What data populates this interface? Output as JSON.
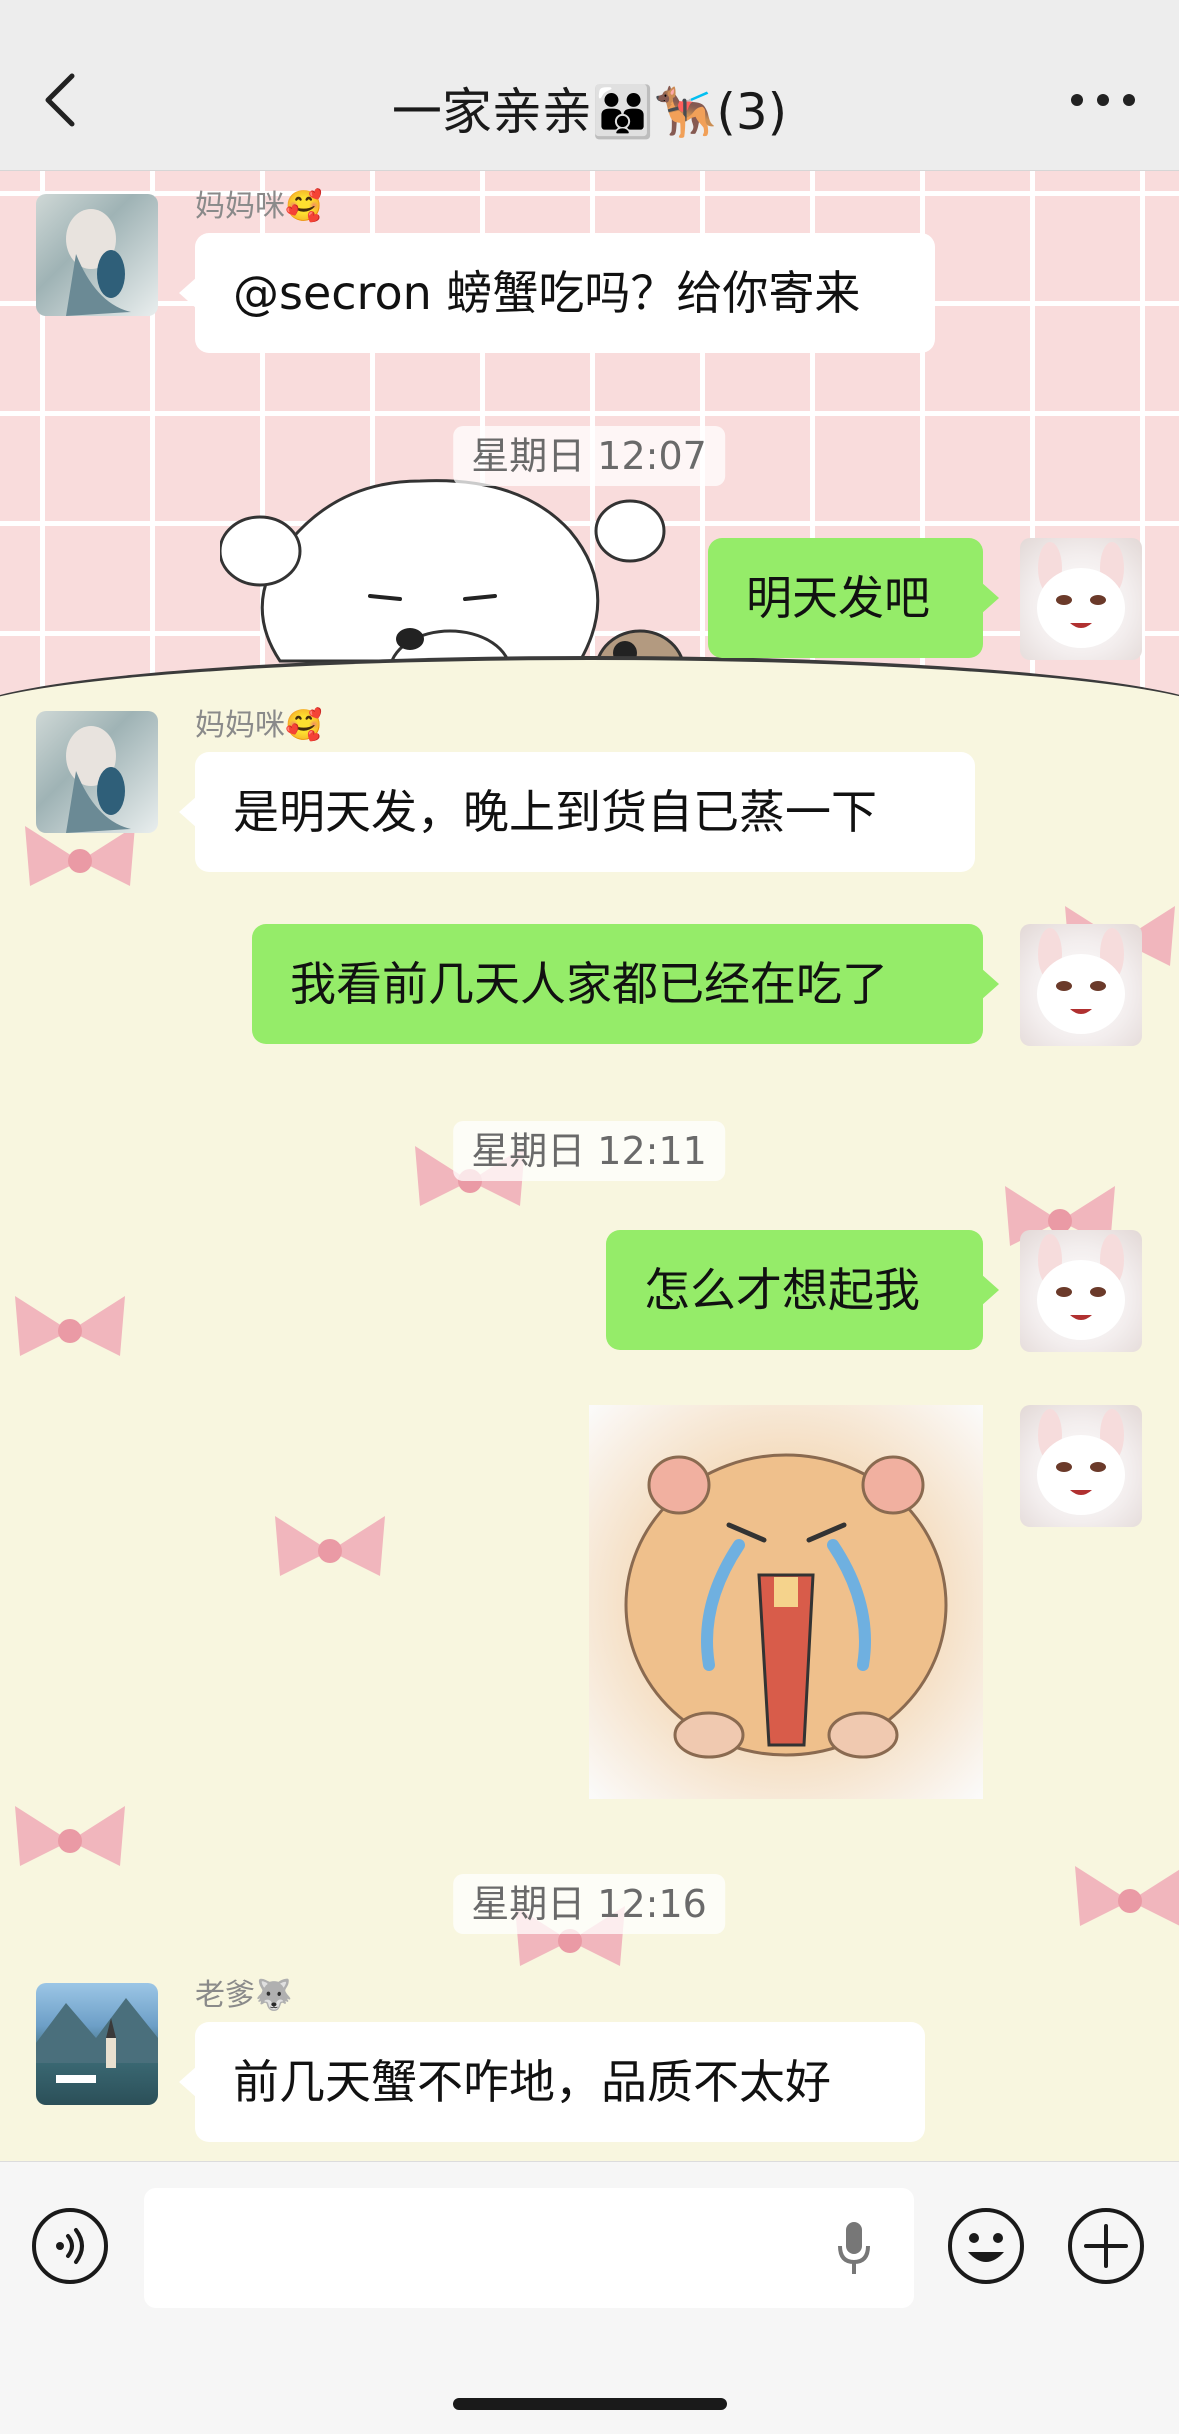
{
  "header": {
    "title": "一家亲亲👪🐕‍🦺(3)"
  },
  "messages": [
    {
      "sender": "妈妈咪🥰",
      "text": "@secron 螃蟹吃吗？给你寄来"
    },
    {
      "time": "星期日 12:07"
    },
    {
      "text": "明天发吧"
    },
    {
      "sender": "妈妈咪🥰",
      "text": "是明天发，晚上到货自已蒸一下"
    },
    {
      "text": "我看前几天人家都已经在吃了"
    },
    {
      "time": "星期日 12:11"
    },
    {
      "text": "怎么才想起我"
    },
    {
      "time": "星期日 12:16"
    },
    {
      "sender": "老爹🐺",
      "text": "前几天蟹不咋地，品质不太好"
    }
  ],
  "icons": {
    "back": "chevron-left-icon",
    "more": "more-dots-icon",
    "voice": "voice-icon",
    "mic": "microphone-icon",
    "emoji": "emoji-icon",
    "plus": "plus-icon"
  },
  "colors": {
    "outgoing_bubble": "#95ec69",
    "incoming_bubble": "#ffffff",
    "header_bg": "#ededed"
  }
}
